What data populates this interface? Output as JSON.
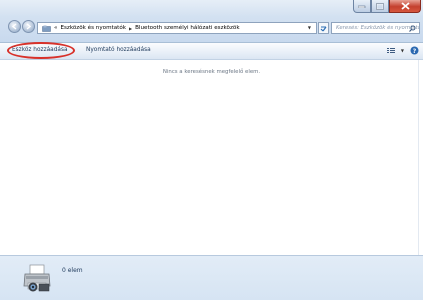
{
  "address": {
    "segments": [
      "Eszközök és nyomtatók",
      "Bluetooth személyi hálózati eszközök"
    ],
    "prefix": "«"
  },
  "search": {
    "placeholder": "Keresés: Eszközök és nyomtatók"
  },
  "toolbar": {
    "add_device_label": "Eszköz hozzáadása",
    "add_printer_label": "Nyomtató hozzáadása"
  },
  "content": {
    "empty_message": "Nincs a keresésnek megfelelő elem."
  },
  "details": {
    "item_count": "0 elem"
  },
  "colors": {
    "highlight": "#d8312a",
    "close_button": "#c4402e"
  },
  "icons": [
    "back-icon",
    "forward-icon",
    "folder-icon",
    "refresh-icon",
    "search-icon",
    "view-options-icon",
    "help-icon",
    "printer-icon"
  ]
}
